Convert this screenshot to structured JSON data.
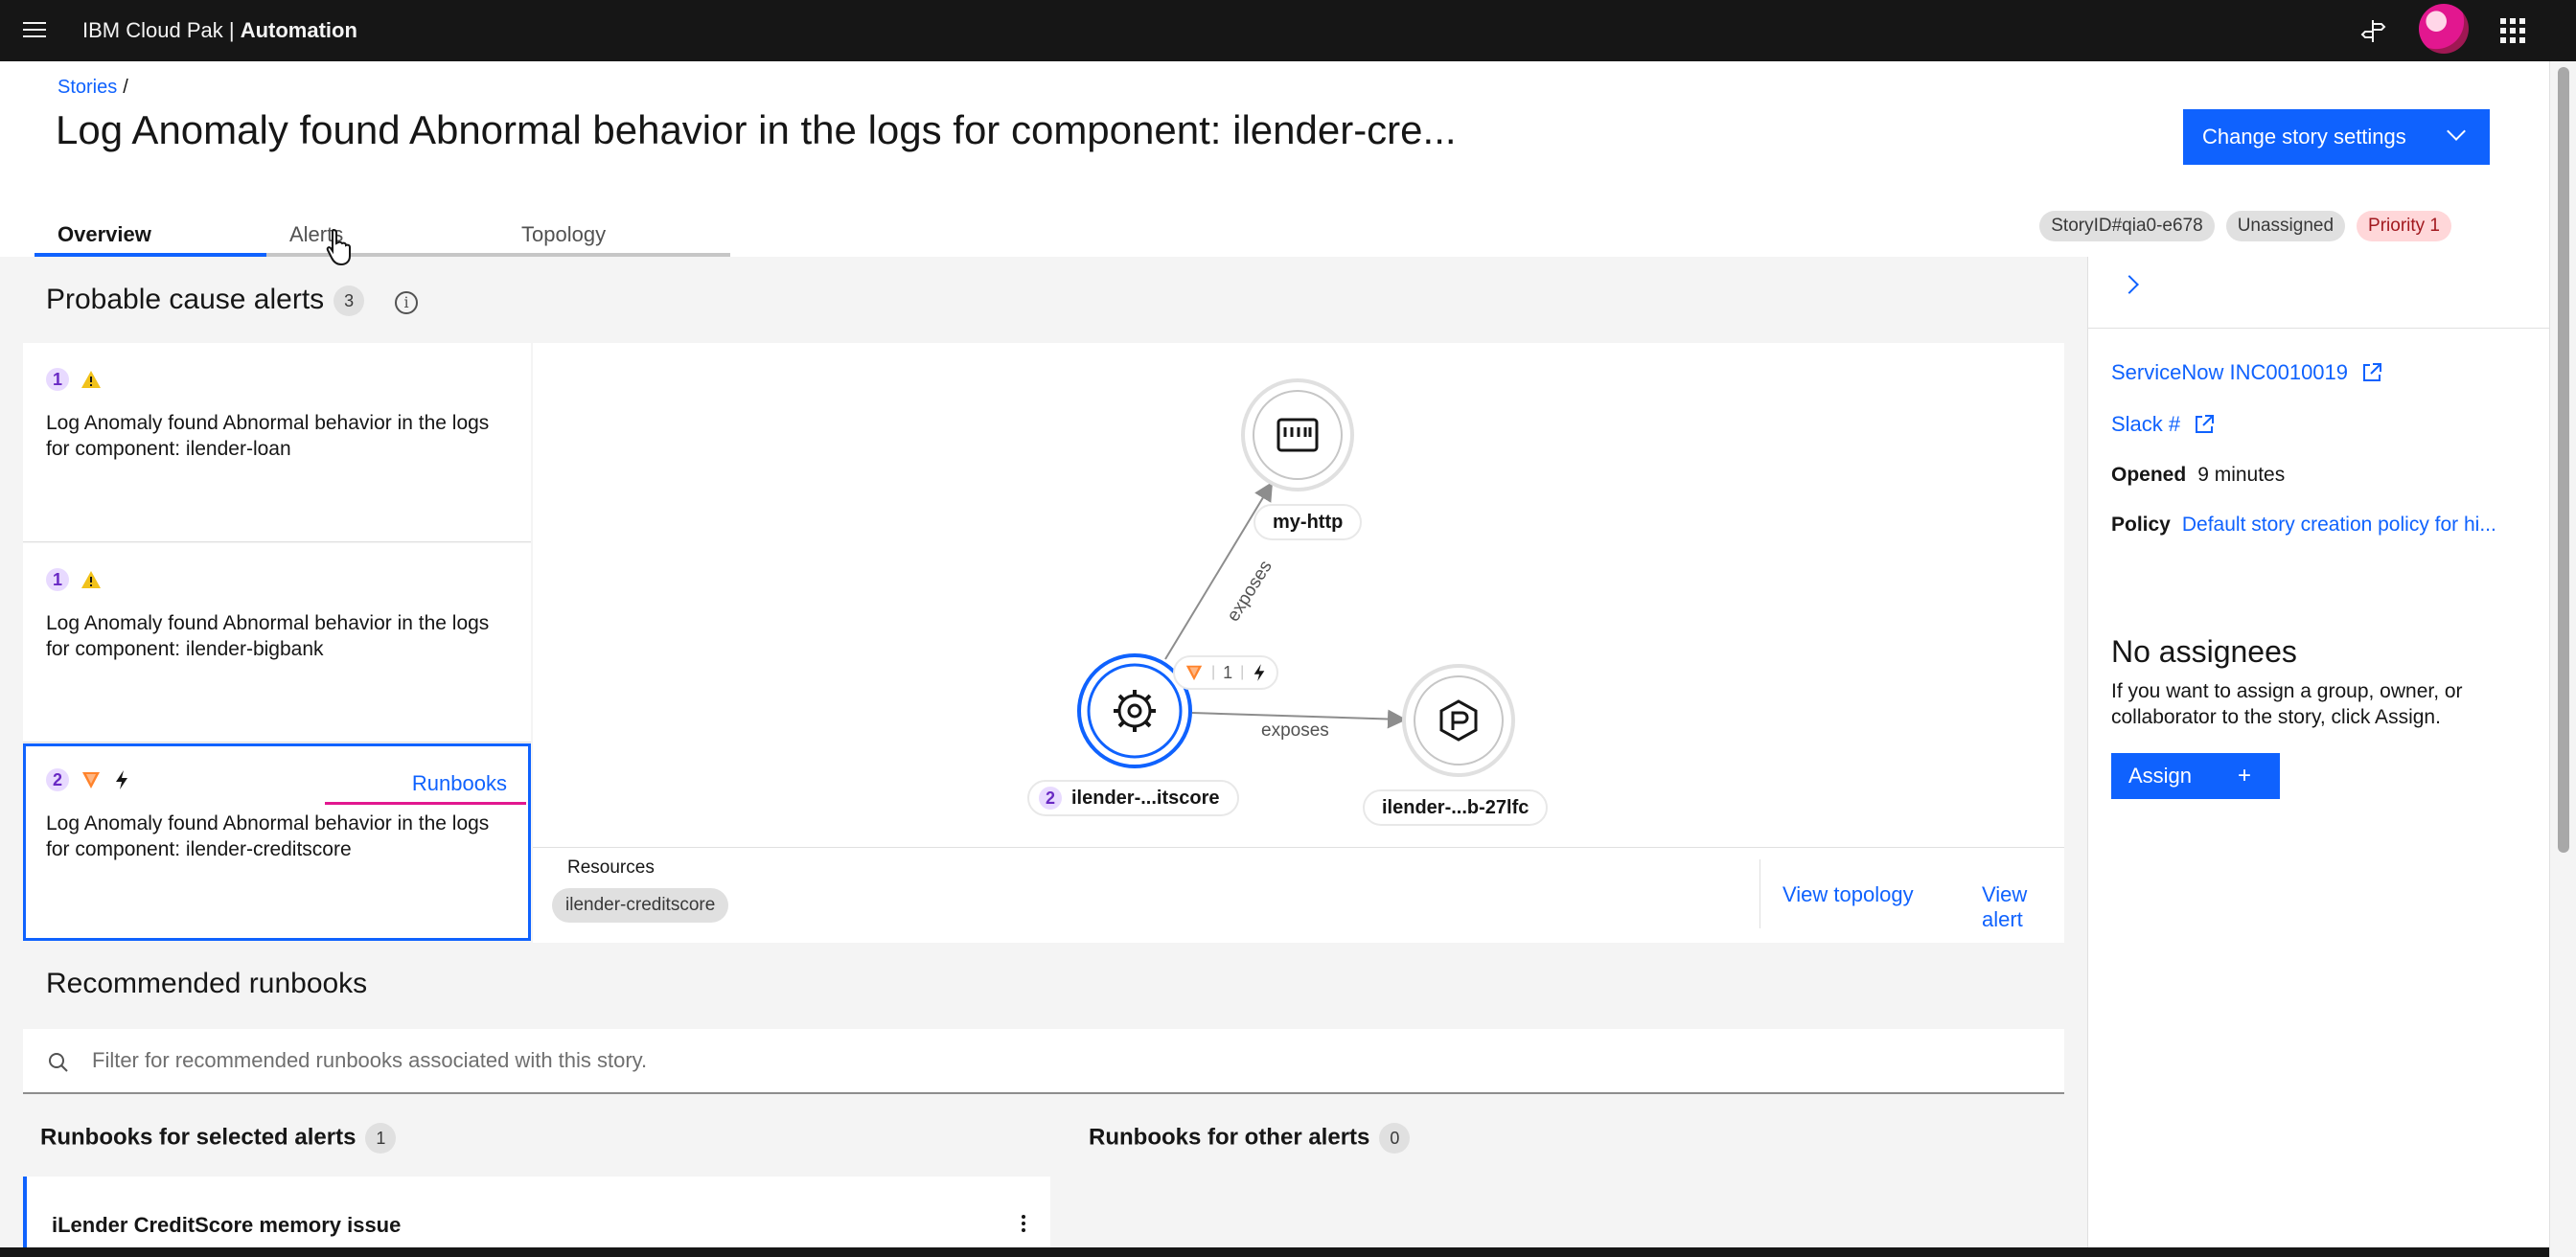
{
  "header": {
    "brand_prefix": "IBM Cloud Pak |",
    "brand_product": "Automation"
  },
  "breadcrumb": {
    "item": "Stories",
    "separator": "/"
  },
  "page": {
    "title": "Log Anomaly found Abnormal behavior in the logs for component: ilender-cre...",
    "story_button": "Change story settings"
  },
  "tabs": [
    {
      "label": "Overview",
      "active": true
    },
    {
      "label": "Alerts",
      "active": false
    },
    {
      "label": "Topology",
      "active": false
    }
  ],
  "tags": {
    "story_id": "StoryID#qia0-e678",
    "assignment": "Unassigned",
    "priority": "Priority 1"
  },
  "probable_cause": {
    "title": "Probable cause alerts",
    "count": "3",
    "alerts": [
      {
        "rank": "1",
        "text": "Log Anomaly found Abnormal behavior in the logs for component: ilender-loan"
      },
      {
        "rank": "1",
        "text": "Log Anomaly found Abnormal behavior in the logs for component: ilender-bigbank"
      },
      {
        "rank": "2",
        "text": "Log Anomaly found Abnormal behavior in the logs for component: ilender-creditscore",
        "runbooks_link": "Runbooks"
      }
    ]
  },
  "topology": {
    "nodes": {
      "http": {
        "label": "my-http",
        "icon": "network-port-icon"
      },
      "service": {
        "label": "ilender-...itscore",
        "badge": "2",
        "icon": "gear-icon"
      },
      "pod": {
        "label": "ilender-...b-27lfc",
        "icon": "package-icon"
      }
    },
    "edges": {
      "edge1": "exposes",
      "edge2": "exposes"
    },
    "status_count": "1"
  },
  "resources": {
    "label": "Resources",
    "chip": "ilender-creditscore",
    "view_topology": "View topology",
    "view_alert": "View alert"
  },
  "recommended": {
    "title": "Recommended runbooks",
    "search_placeholder": "Filter for recommended runbooks associated with this story.",
    "selected_title": "Runbooks for selected alerts",
    "selected_count": "1",
    "other_title": "Runbooks for other alerts",
    "other_count": "0",
    "runbook_name": "iLender CreditScore memory issue"
  },
  "side_panel": {
    "servicenow": "ServiceNow INC0010019",
    "slack": "Slack #",
    "opened_label": "Opened",
    "opened_value": "9 minutes",
    "policy_label": "Policy",
    "policy_value": "Default story creation policy for hi...",
    "no_assignees": "No assignees",
    "assign_hint": "If you want to assign a group, owner, or collaborator to the story, click Assign.",
    "assign_button": "Assign",
    "assign_plus": "+"
  },
  "colors": {
    "accent": "#0f62fe",
    "header_bg": "#161616",
    "priority_bg": "#ffd7d9",
    "warning": "#f1c21b",
    "severity_orange": "#ff832b",
    "underline_magenta": "#e2178f"
  }
}
